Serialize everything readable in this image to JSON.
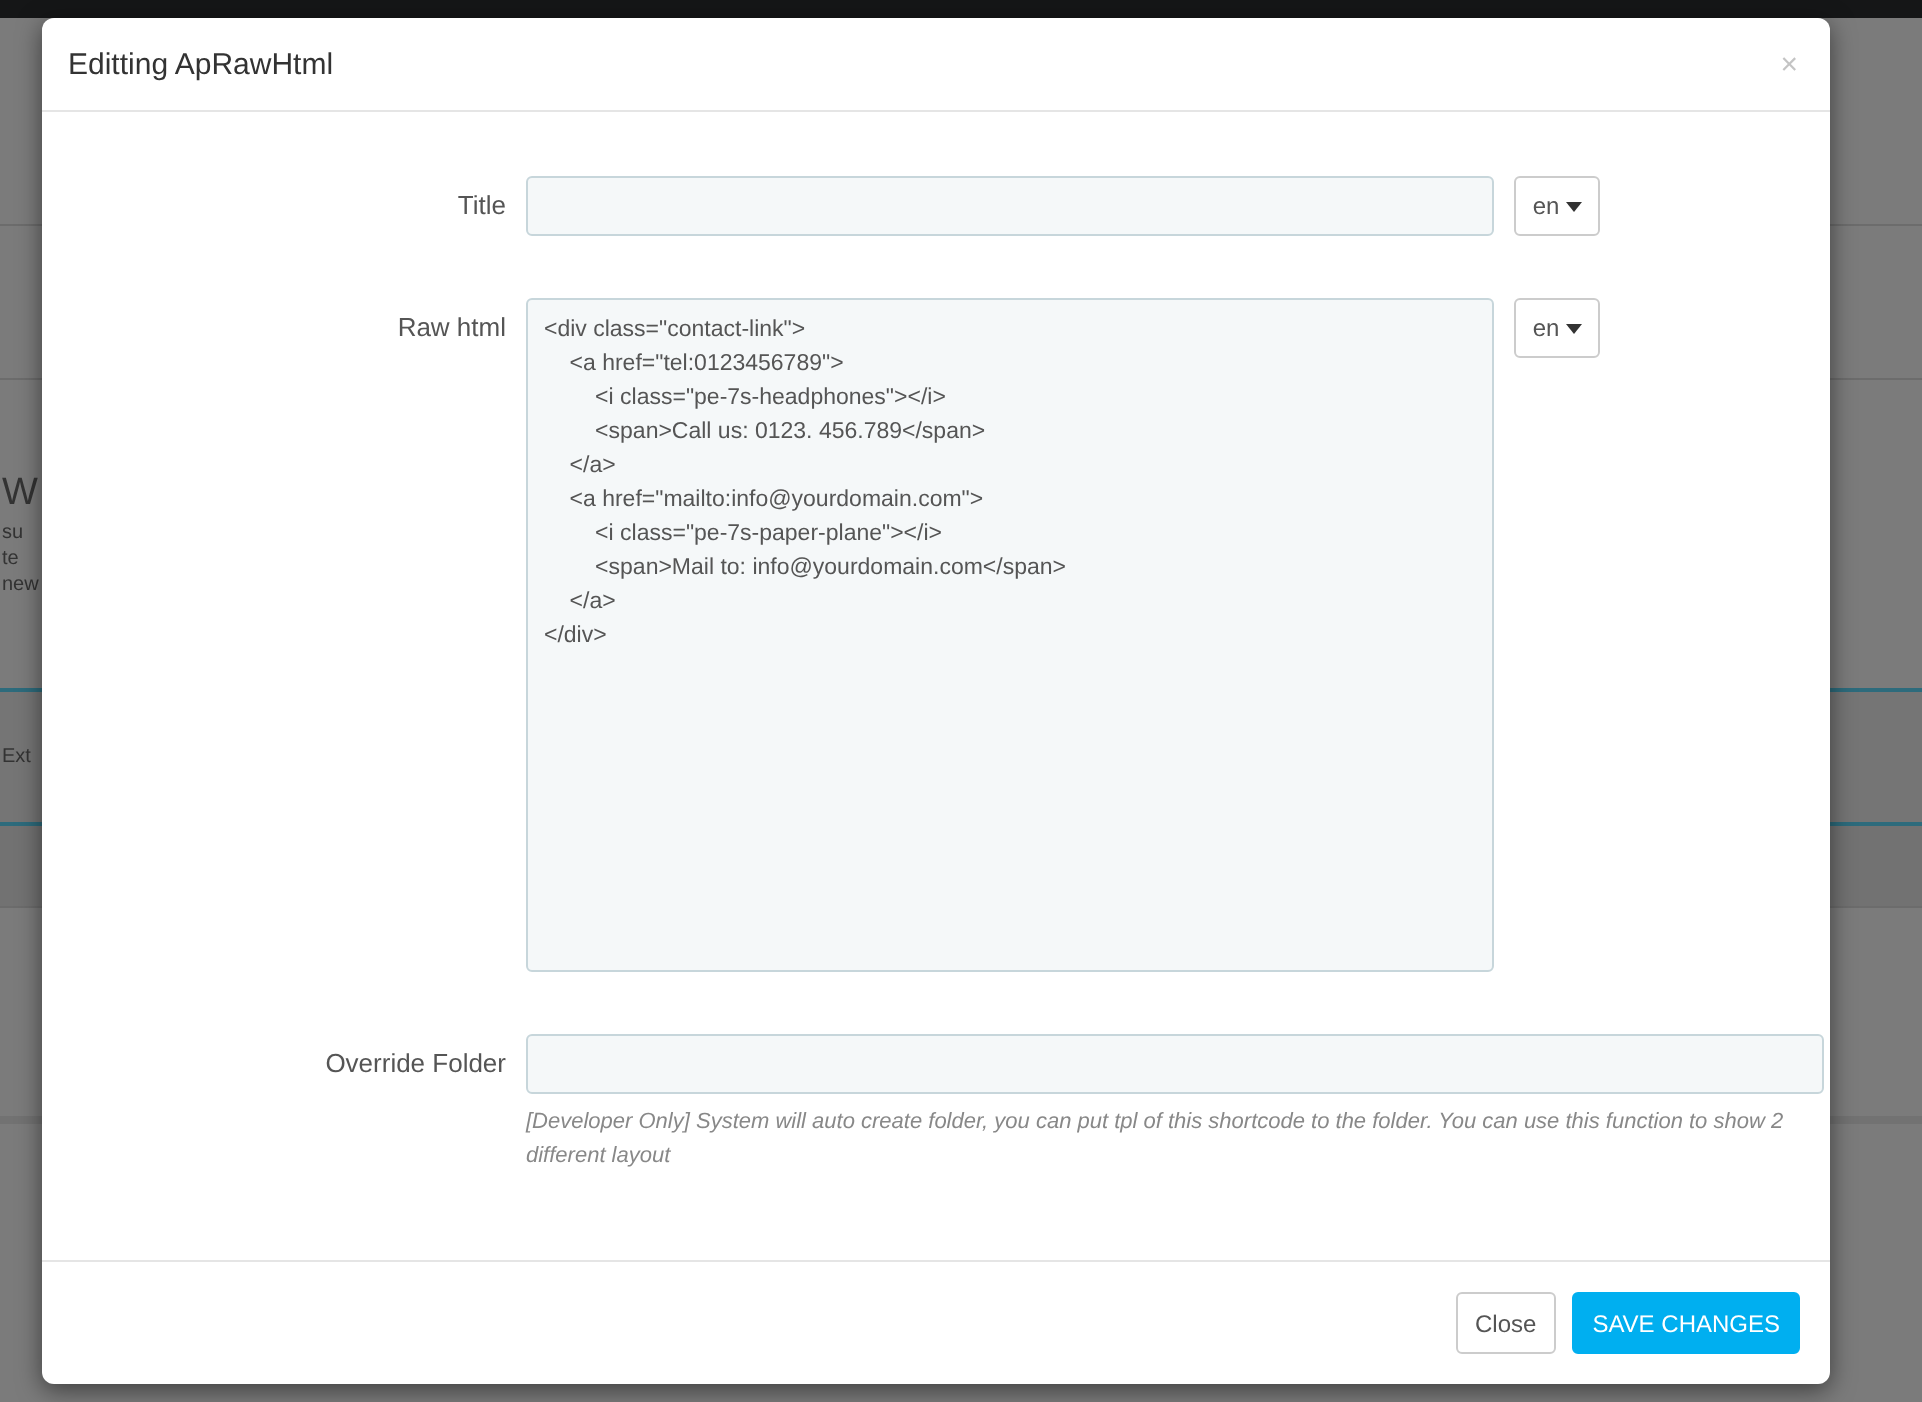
{
  "background": {
    "fragments": [
      "W",
      "su",
      "te",
      "new",
      "Ext"
    ]
  },
  "modal": {
    "title": "Editting ApRawHtml",
    "close": "×"
  },
  "fields": [
    {
      "kind": "input",
      "label": "Title",
      "language": "en"
    },
    {
      "kind": "textarea",
      "label": "Raw html",
      "language": "en",
      "value": "<div class=\"contact-link\">\n    <a href=\"tel:0123456789\">\n        <i class=\"pe-7s-headphones\"></i>\n        <span>Call us: 0123. 456.789</span>\n    </a>\n    <a href=\"mailto:info@yourdomain.com\">\n        <i class=\"pe-7s-paper-plane\"></i>\n        <span>Mail to: info@yourdomain.com</span>\n    </a>\n</div>"
    },
    {
      "kind": "input",
      "label": "Override Folder",
      "help": "[Developer Only] System will auto create folder, you can put tpl of this shortcode to the folder. You can use this function to show 2 different layout"
    }
  ],
  "buttons": [
    {
      "label": "Close",
      "kind": "default"
    },
    {
      "label": "SAVE CHANGES",
      "kind": "primary"
    }
  ]
}
